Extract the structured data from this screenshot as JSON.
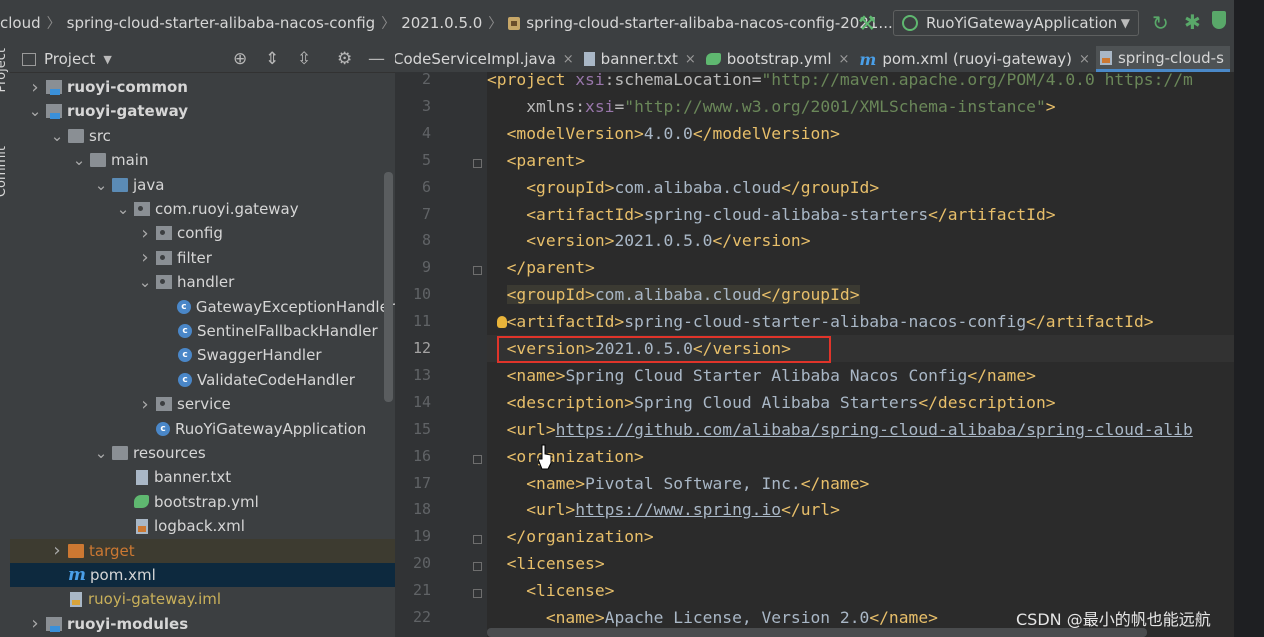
{
  "breadcrumb": {
    "items": [
      "cloud",
      "spring-cloud-starter-alibaba-nacos-config",
      "2021.0.5.0",
      "spring-cloud-starter-alibaba-nacos-config-2021...."
    ]
  },
  "toolbar": {
    "run_config": "RuoYiGatewayApplication"
  },
  "left_strip": {
    "project_label": "Project",
    "commit_label": "Commit"
  },
  "project_panel": {
    "title": "Project",
    "tree": [
      {
        "label": "ruoyi-common",
        "level": 0,
        "kind": "module",
        "expanded": false
      },
      {
        "label": "ruoyi-gateway",
        "level": 0,
        "kind": "module",
        "expanded": true
      },
      {
        "label": "src",
        "level": 1,
        "kind": "folder",
        "expanded": true
      },
      {
        "label": "main",
        "level": 2,
        "kind": "folder",
        "expanded": true
      },
      {
        "label": "java",
        "level": 3,
        "kind": "src-folder",
        "expanded": true
      },
      {
        "label": "com.ruoyi.gateway",
        "level": 4,
        "kind": "package",
        "expanded": true
      },
      {
        "label": "config",
        "level": 5,
        "kind": "package",
        "expanded": false
      },
      {
        "label": "filter",
        "level": 5,
        "kind": "package",
        "expanded": false
      },
      {
        "label": "handler",
        "level": 5,
        "kind": "package",
        "expanded": true
      },
      {
        "label": "GatewayExceptionHandler",
        "level": 6,
        "kind": "class"
      },
      {
        "label": "SentinelFallbackHandler",
        "level": 6,
        "kind": "class"
      },
      {
        "label": "SwaggerHandler",
        "level": 6,
        "kind": "class"
      },
      {
        "label": "ValidateCodeHandler",
        "level": 6,
        "kind": "class"
      },
      {
        "label": "service",
        "level": 5,
        "kind": "package",
        "expanded": false
      },
      {
        "label": "RuoYiGatewayApplication",
        "level": 5,
        "kind": "class"
      },
      {
        "label": "resources",
        "level": 3,
        "kind": "res-folder",
        "expanded": true
      },
      {
        "label": "banner.txt",
        "level": 4,
        "kind": "txt"
      },
      {
        "label": "bootstrap.yml",
        "level": 4,
        "kind": "yml"
      },
      {
        "label": "logback.xml",
        "level": 4,
        "kind": "xml"
      },
      {
        "label": "target",
        "level": 1,
        "kind": "target",
        "expanded": false
      },
      {
        "label": "pom.xml",
        "level": 1,
        "kind": "maven",
        "selected": true
      },
      {
        "label": "ruoyi-gateway.iml",
        "level": 1,
        "kind": "iml"
      },
      {
        "label": "ruoyi-modules",
        "level": 0,
        "kind": "module",
        "expanded": false
      }
    ]
  },
  "tabs": [
    {
      "label": "CodeServiceImpl.java",
      "icon": "java-class-icon"
    },
    {
      "label": "banner.txt",
      "icon": "text-file-icon"
    },
    {
      "label": "bootstrap.yml",
      "icon": "yml-file-icon"
    },
    {
      "label": "pom.xml (ruoyi-gateway)",
      "icon": "maven-icon"
    },
    {
      "label": "spring-cloud-s",
      "icon": "pom-file-icon",
      "active": true
    }
  ],
  "editor": {
    "current_line": 12,
    "lines": [
      {
        "n": "2",
        "html": "<span class=\"tag\">&lt;project </span><span class=\"ns\">xsi</span><span class=\"attr\">:schemaLocation=</span><span class=\"str\">\"http://maven.apache.org/POM/4.0.0 https://m</span>"
      },
      {
        "n": "3",
        "html": "    <span class=\"attr\">xmlns:</span><span class=\"ns\">xsi</span><span class=\"attr\">=</span><span class=\"str\">\"http://www.w3.org/2001/XMLSchema-instance\"</span><span class=\"tag\">&gt;</span>"
      },
      {
        "n": "4",
        "html": "  <span class=\"tag\">&lt;modelVersion&gt;</span>4.0.0<span class=\"tag\">&lt;/modelVersion&gt;</span>"
      },
      {
        "n": "5",
        "html": "  <span class=\"tag\">&lt;parent&gt;</span>"
      },
      {
        "n": "6",
        "html": "    <span class=\"tag\">&lt;groupId&gt;</span>com.alibaba.cloud<span class=\"tag\">&lt;/groupId&gt;</span>"
      },
      {
        "n": "7",
        "html": "    <span class=\"tag\">&lt;artifactId&gt;</span>spring-cloud-alibaba-starters<span class=\"tag\">&lt;/artifactId&gt;</span>"
      },
      {
        "n": "8",
        "html": "    <span class=\"tag\">&lt;version&gt;</span>2021.0.5.0<span class=\"tag\">&lt;/version&gt;</span>"
      },
      {
        "n": "9",
        "html": "  <span class=\"tag\">&lt;/parent&gt;</span>"
      },
      {
        "n": "10",
        "html": "  <span class=\"hl-bg\"><span class=\"tag\">&lt;groupId&gt;</span>com.alibaba.cloud<span class=\"tag\">&lt;/groupId&gt;</span></span>"
      },
      {
        "n": "11",
        "html": "  <span class=\"tag\">&lt;artifactId&gt;</span>spring-cloud-starter-alibaba-nacos-config<span class=\"tag\">&lt;/artifactId&gt;</span>"
      },
      {
        "n": "12",
        "html": "  <span class=\"tag\">&lt;version&gt;</span>2021.0.5.0<span class=\"tag\">&lt;/version&gt;</span>"
      },
      {
        "n": "13",
        "html": "  <span class=\"tag\">&lt;name&gt;</span>Spring Cloud Starter Alibaba Nacos Config<span class=\"tag\">&lt;/name&gt;</span>"
      },
      {
        "n": "14",
        "html": "  <span class=\"tag\">&lt;description&gt;</span>Spring Cloud Alibaba Starters<span class=\"tag\">&lt;/description&gt;</span>"
      },
      {
        "n": "15",
        "html": "  <span class=\"tag\">&lt;url&gt;</span><span class=\"url\">https://github.com/alibaba/spring-cloud-alibaba/spring-cloud-alib</span>"
      },
      {
        "n": "16",
        "html": "  <span class=\"tag\">&lt;organization&gt;</span>"
      },
      {
        "n": "17",
        "html": "    <span class=\"tag\">&lt;name&gt;</span>Pivotal Software, Inc.<span class=\"tag\">&lt;/name&gt;</span>"
      },
      {
        "n": "18",
        "html": "    <span class=\"tag\">&lt;url&gt;</span><span class=\"url\">https://www.spring.io</span><span class=\"tag\">&lt;/url&gt;</span>"
      },
      {
        "n": "19",
        "html": "  <span class=\"tag\">&lt;/organization&gt;</span>"
      },
      {
        "n": "20",
        "html": "  <span class=\"tag\">&lt;licenses&gt;</span>"
      },
      {
        "n": "21",
        "html": "    <span class=\"tag\">&lt;license&gt;</span>"
      },
      {
        "n": "22",
        "html": "      <span class=\"tag\">&lt;name&gt;</span>Apache License, Version 2.0<span class=\"tag\">&lt;/name&gt;</span>"
      }
    ]
  },
  "watermark": "CSDN @最小的帆也能远航",
  "colors": {
    "accent": "#4a88c7",
    "highlight_box": "#e0342a",
    "tag": "#e8bf6a"
  }
}
